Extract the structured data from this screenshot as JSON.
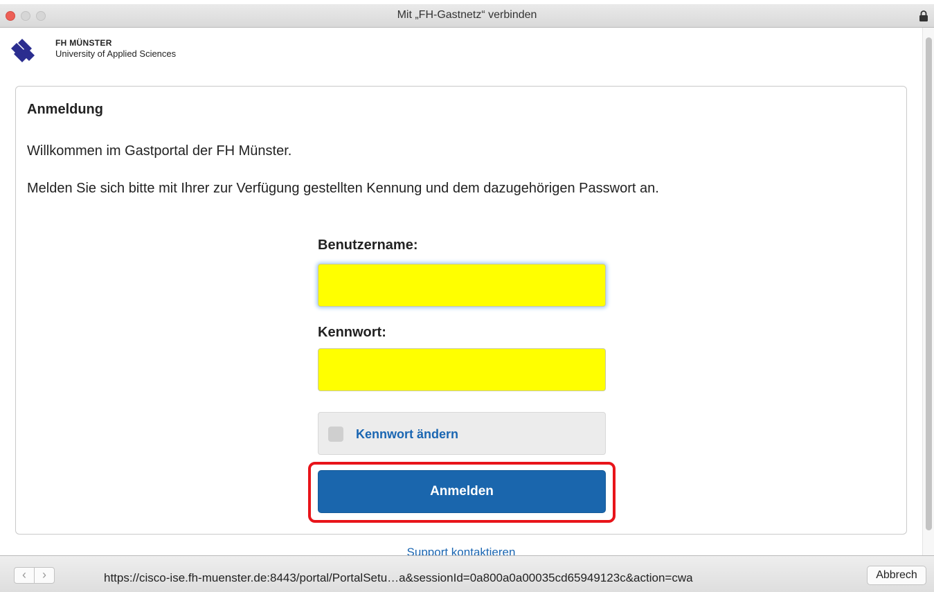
{
  "window": {
    "title": "Mit „FH-Gastnetz“ verbinden",
    "icons": {
      "close": "close-dot-icon",
      "minimize": "minimize-dot-icon",
      "maximize": "maximize-dot-icon",
      "lock": "lock-icon"
    }
  },
  "brand": {
    "name": "FH MÜNSTER",
    "subtitle": "University of Applied Sciences",
    "logo_icon": "fh-logo-icon",
    "color": "#2b2d8f"
  },
  "login": {
    "heading": "Anmeldung",
    "welcome": "Willkommen im Gastportal der FH Münster.",
    "instruction": "Melden Sie sich bitte mit Ihrer zur Verfügung gestellten Kennung und dem dazugehörigen Passwort an.",
    "username_label": "Benutzername:",
    "username_value": "",
    "password_label": "Kennwort:",
    "password_value": "",
    "change_password_label": "Kennwort ändern",
    "change_password_checked": false,
    "submit_label": "Anmelden",
    "field_color": "#ffff00",
    "submit_color": "#1a66ad",
    "highlight_color": "#e8141a"
  },
  "footer": {
    "support_link": "Support kontaktieren"
  },
  "bottombar": {
    "back_glyph": "‹",
    "forward_glyph": "›",
    "url": "https://cisco-ise.fh-muenster.de:8443/portal/PortalSetu…a&sessionId=0a800a0a00035cd65949123c&action=cwa",
    "cancel_label": "Abbrech"
  }
}
